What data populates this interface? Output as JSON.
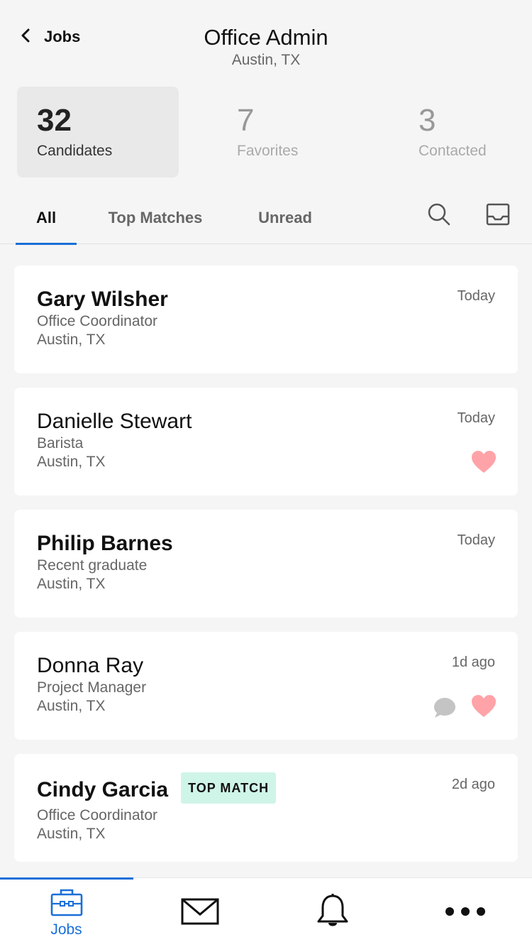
{
  "header": {
    "back_label": "Jobs",
    "title": "Office Admin",
    "subtitle": "Austin, TX"
  },
  "stats": [
    {
      "count": "32",
      "label": "Candidates",
      "active": true
    },
    {
      "count": "7",
      "label": "Favorites",
      "active": false
    },
    {
      "count": "3",
      "label": "Contacted",
      "active": false
    }
  ],
  "tabs": [
    {
      "label": "All",
      "active": true
    },
    {
      "label": "Top Matches",
      "active": false
    },
    {
      "label": "Unread",
      "active": false
    }
  ],
  "tab_icons": [
    "search-icon",
    "inbox-icon"
  ],
  "candidates": [
    {
      "name": "Gary Wilsher",
      "role": "Office Coordinator",
      "location": "Austin, TX",
      "time": "Today",
      "unread": true,
      "favorite": false,
      "messaged": false,
      "badge": ""
    },
    {
      "name": "Danielle Stewart",
      "role": "Barista",
      "location": "Austin, TX",
      "time": "Today",
      "unread": false,
      "favorite": true,
      "messaged": false,
      "badge": ""
    },
    {
      "name": "Philip Barnes",
      "role": "Recent graduate",
      "location": "Austin, TX",
      "time": "Today",
      "unread": true,
      "favorite": false,
      "messaged": false,
      "badge": ""
    },
    {
      "name": "Donna Ray",
      "role": "Project Manager",
      "location": "Austin, TX",
      "time": "1d ago",
      "unread": false,
      "favorite": true,
      "messaged": true,
      "badge": ""
    },
    {
      "name": "Cindy Garcia",
      "role": "Office Coordinator",
      "location": "Austin, TX",
      "time": "2d ago",
      "unread": true,
      "favorite": false,
      "messaged": false,
      "badge": "TOP  MATCH"
    }
  ],
  "bottom_nav": {
    "jobs_label": "Jobs",
    "items": [
      "briefcase-icon",
      "mail-icon",
      "bell-icon",
      "more-icon"
    ]
  },
  "colors": {
    "accent": "#1a6fd8",
    "favorite": "#ffa3a8",
    "badge_bg": "#cff5e8",
    "message": "#c4c4c4"
  }
}
